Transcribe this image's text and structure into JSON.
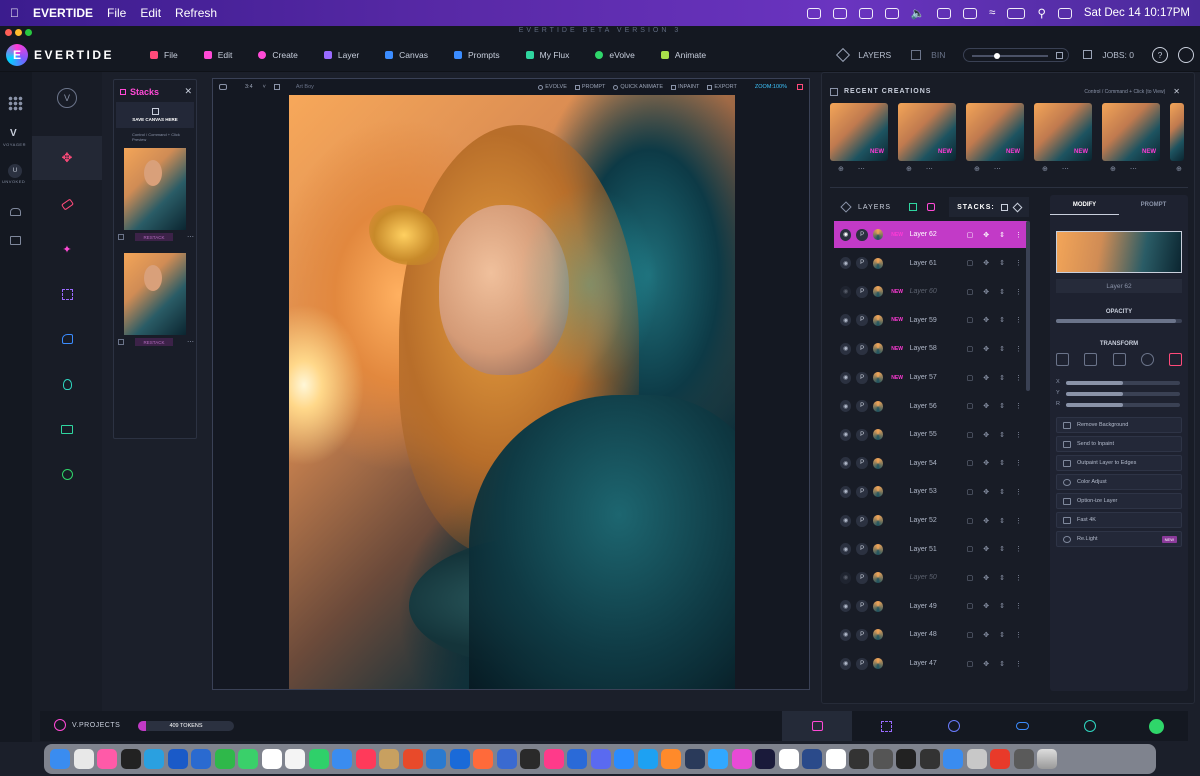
{
  "menubar": {
    "app": "EVERTIDE",
    "items": [
      "File",
      "Edit",
      "Refresh"
    ],
    "datetime": "Sat Dec 14  10:17PM"
  },
  "window": {
    "title": "EVERTIDE BETA VERSION 3"
  },
  "header": {
    "brand": "EVERTIDE",
    "menus": [
      {
        "label": "File",
        "color": "#ff4a7a"
      },
      {
        "label": "Edit",
        "color": "#ff4ad6"
      },
      {
        "label": "Create",
        "color": "#ff4ad6"
      },
      {
        "label": "Layer",
        "color": "#9a6bff"
      },
      {
        "label": "Canvas",
        "color": "#3b8cff"
      },
      {
        "label": "Prompts",
        "color": "#3b8cff"
      },
      {
        "label": "My Flux",
        "color": "#2fd6a0"
      },
      {
        "label": "eVolve",
        "color": "#2fd66a"
      },
      {
        "label": "Animate",
        "color": "#a8e04a"
      }
    ],
    "layers_label": "LAYERS",
    "bin_label": "BIN",
    "jobs_label": "JOBS: 0",
    "help": "?"
  },
  "rail": {
    "voyager": "VOYAGER",
    "univoked": "UNVOKED"
  },
  "stacks": {
    "title": "Stacks",
    "save_label": "SAVE CANVAS HERE",
    "hint": "Control / Command + Click Preview",
    "restack": "RESTACK"
  },
  "canvas": {
    "ratio": "3:4",
    "name": "Art Boy",
    "evolve": "EVOLVE",
    "prompt": "PROMPT",
    "quick_animate": "QUICK ANIMATE",
    "inpaint": "INPAINT",
    "export": "EXPORT",
    "zoom": "ZOOM:100%"
  },
  "recent": {
    "title": "RECENT CREATIONS",
    "hint": "Control / Command + Click (to View)",
    "new_badge": "NEW"
  },
  "layers": {
    "tab_layers": "LAYERS",
    "tab_stacks": "STACKS:",
    "rows": [
      {
        "name": "Layer 62",
        "new": "NEW",
        "hidden": false
      },
      {
        "name": "Layer 61",
        "new": "",
        "hidden": false
      },
      {
        "name": "Layer 60",
        "new": "NEW",
        "hidden": true
      },
      {
        "name": "Layer 59",
        "new": "NEW",
        "hidden": false
      },
      {
        "name": "Layer 58",
        "new": "NEW",
        "hidden": false
      },
      {
        "name": "Layer 57",
        "new": "NEW",
        "hidden": false
      },
      {
        "name": "Layer 56",
        "new": "",
        "hidden": false
      },
      {
        "name": "Layer 55",
        "new": "",
        "hidden": false
      },
      {
        "name": "Layer 54",
        "new": "",
        "hidden": false
      },
      {
        "name": "Layer 53",
        "new": "",
        "hidden": false
      },
      {
        "name": "Layer 52",
        "new": "",
        "hidden": false
      },
      {
        "name": "Layer 51",
        "new": "",
        "hidden": false
      },
      {
        "name": "Layer 50",
        "new": "",
        "hidden": true
      },
      {
        "name": "Layer 49",
        "new": "",
        "hidden": false
      },
      {
        "name": "Layer 48",
        "new": "",
        "hidden": false
      },
      {
        "name": "Layer 47",
        "new": "",
        "hidden": false
      }
    ],
    "p_label": "P"
  },
  "modify": {
    "tab_modify": "MODIFY",
    "tab_prompt": "PROMPT",
    "layer_name": "Layer 62",
    "opacity_label": "OPACITY",
    "opacity_value": 0.95,
    "transform_label": "TRANSFORM",
    "x_label": "X",
    "y_label": "Y",
    "r_label": "R",
    "x_value": 0.5,
    "y_value": 0.5,
    "r_value": 0.5,
    "actions": [
      "Remove Background",
      "Send to Inpaint",
      "Outpaint Layer to Edges",
      "Color Adjust",
      "Option-ize Layer",
      "Fast 4K",
      "Re.Light"
    ],
    "relight_badge": "NEW"
  },
  "bottom": {
    "projects": "V.PROJECTS",
    "tokens": "409 TOKENS",
    "token_fill": 0.08
  }
}
